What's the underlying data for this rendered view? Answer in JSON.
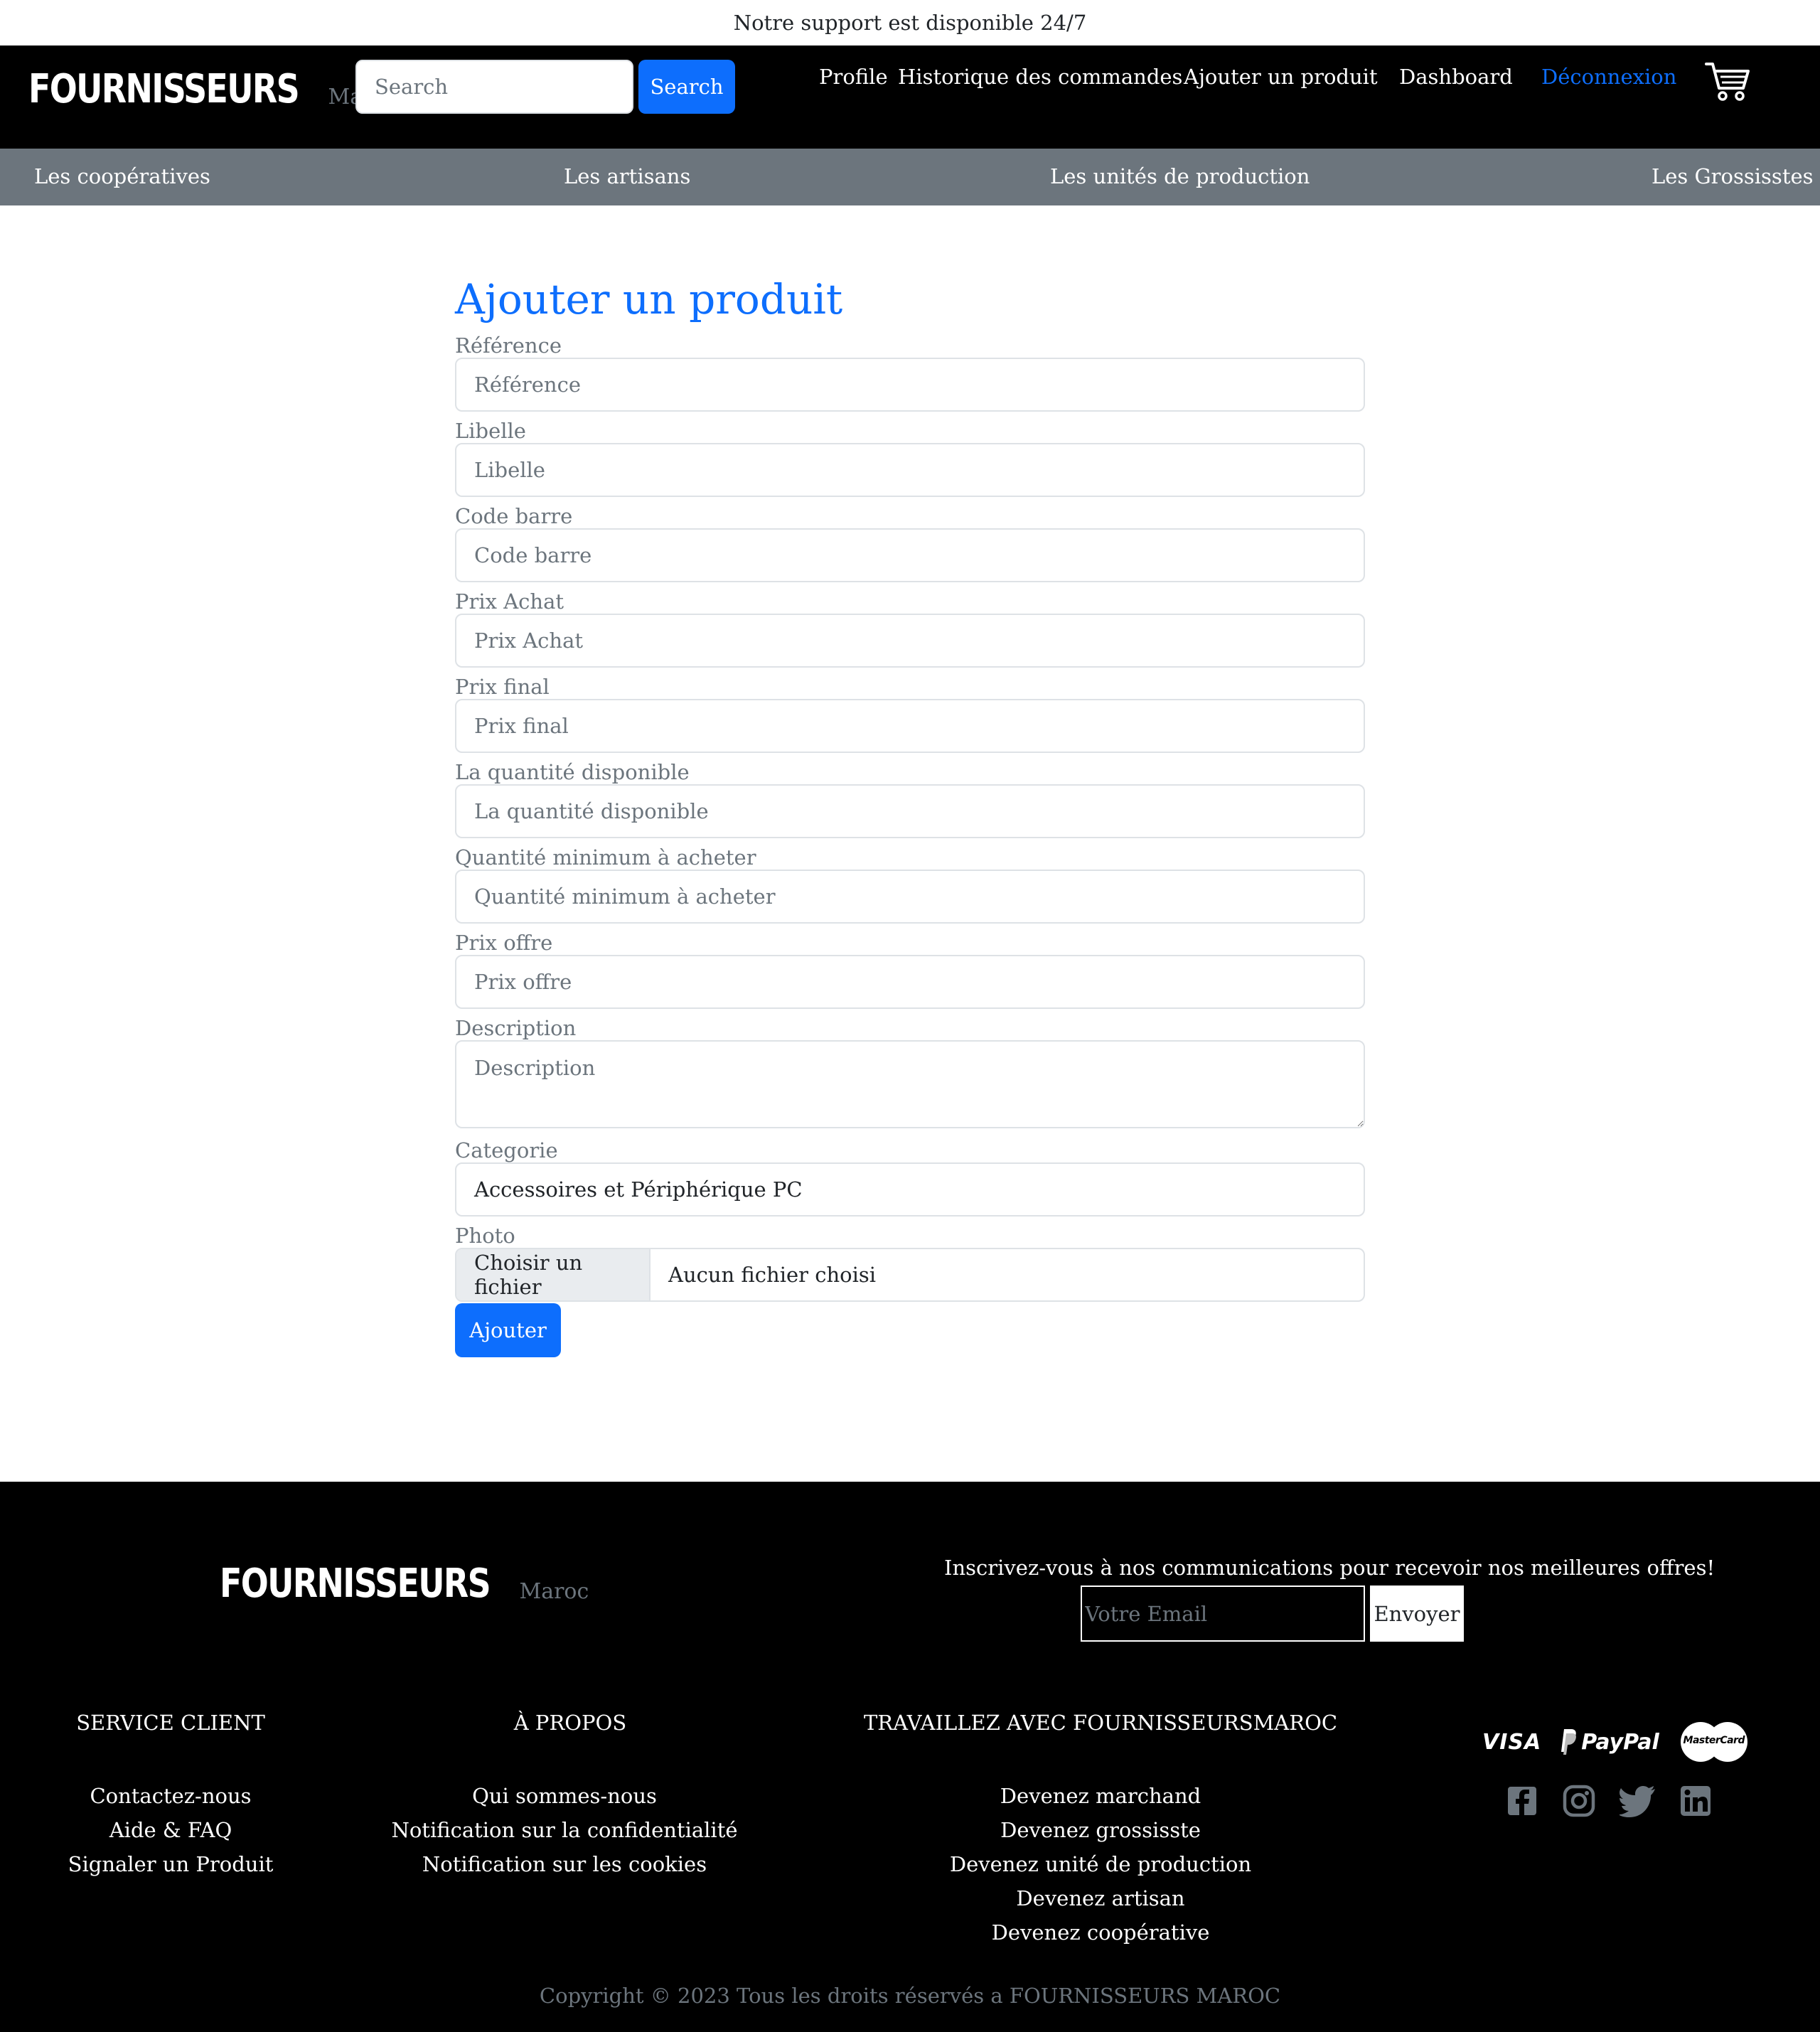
{
  "topbar": {
    "support_text": "Notre support est disponible 24/7"
  },
  "header": {
    "logo_main": "FOURNISSEURS",
    "logo_sub": "Maroc",
    "search_placeholder": "Search",
    "search_button": "Search",
    "nav": {
      "profile": "Profile",
      "history": "Historique des commandes",
      "add_product": "Ajouter un produit",
      "dashboard": "Dashboard",
      "logout": "Déconnexion"
    },
    "cart_icon": "cart-icon",
    "accent_color": "#0d6efd"
  },
  "subnav": {
    "cooperatives": "Les coopératives",
    "artisans": "Les artisans",
    "production_units": "Les unités de production",
    "wholesalers": "Les Grossisstes"
  },
  "form": {
    "title": "Ajouter un produit",
    "fields": {
      "reference": {
        "label": "Référence",
        "placeholder": "Référence"
      },
      "libelle": {
        "label": "Libelle",
        "placeholder": "Libelle"
      },
      "barcode": {
        "label": "Code barre",
        "placeholder": "Code barre"
      },
      "purchase_price": {
        "label": "Prix Achat",
        "placeholder": "Prix Achat"
      },
      "final_price": {
        "label": "Prix final",
        "placeholder": "Prix final"
      },
      "quantity": {
        "label": "La quantité disponible",
        "placeholder": "La quantité disponible"
      },
      "min_quantity": {
        "label": "Quantité minimum à acheter",
        "placeholder": "Quantité minimum à acheter"
      },
      "offer_price": {
        "label": "Prix offre",
        "placeholder": "Prix offre"
      },
      "description": {
        "label": "Description",
        "placeholder": "Description"
      },
      "category": {
        "label": "Categorie",
        "value": "Accessoires et Périphérique PC"
      },
      "photo": {
        "label": "Photo",
        "button": "Choisir un fichier",
        "status": "Aucun fichier choisi"
      }
    },
    "submit": "Ajouter"
  },
  "footer": {
    "logo_main": "FOURNISSEURS",
    "logo_sub": "Maroc",
    "newsletter_text": "Inscrivez-vous à nos communications pour recevoir nos meilleures offres!",
    "email_placeholder": "Votre Email",
    "send_button": "Envoyer",
    "service_client": {
      "title": "SERVICE CLIENT",
      "links": [
        "Contactez-nous",
        "Aide & FAQ",
        "Signaler un Produit"
      ]
    },
    "about": {
      "title": "À PROPOS",
      "links": [
        "Qui sommes-nous",
        "Notification sur la confidentialité",
        "Notification sur les cookies"
      ]
    },
    "work_with": {
      "title": "TRAVAILLEZ AVEC FOURNISSEURSMAROC",
      "links": [
        "Devenez marchand",
        "Devenez grossisste",
        "Devenez unité de production",
        "Devenez artisan",
        "Devenez coopérative"
      ]
    },
    "payment": {
      "visa": "VISA",
      "paypal": "PayPal",
      "mastercard": "MasterCard"
    },
    "social_icons": [
      "facebook-icon",
      "instagram-icon",
      "twitter-icon",
      "linkedin-icon"
    ],
    "copyright": "Copyright © 2023 Tous les droits réservés a FOURNISSEURS MAROC"
  }
}
